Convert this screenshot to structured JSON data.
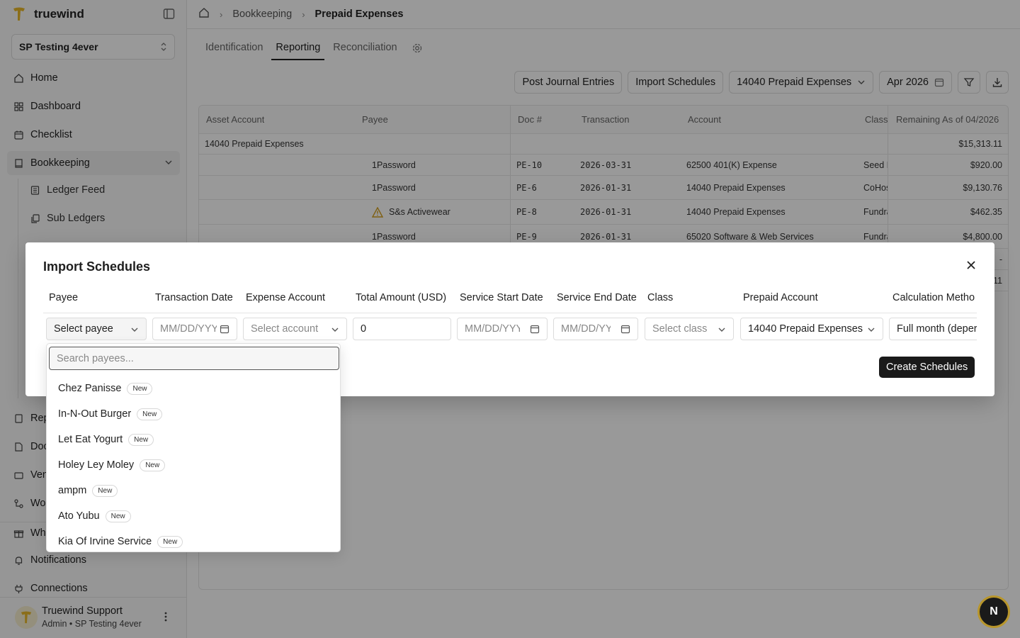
{
  "app": {
    "name": "truewind",
    "brand_color": "#e8b82a"
  },
  "sidebar": {
    "org": "SP Testing 4ever",
    "items": [
      {
        "label": "Home",
        "icon": "home-icon"
      },
      {
        "label": "Dashboard",
        "icon": "dashboard-icon"
      },
      {
        "label": "Checklist",
        "icon": "calendar-icon"
      },
      {
        "label": "Bookkeeping",
        "icon": "book-icon"
      }
    ],
    "sub_items": [
      {
        "label": "Ledger Feed",
        "icon": "ledger-icon"
      },
      {
        "label": "Sub Ledgers",
        "icon": "copy-icon"
      }
    ],
    "lower_items": [
      {
        "label": "Rep",
        "icon": "report-icon"
      },
      {
        "label": "Doc",
        "icon": "document-icon"
      },
      {
        "label": "Ven",
        "icon": "vendor-icon"
      },
      {
        "label": "Wor",
        "icon": "workflow-icon"
      },
      {
        "label": "Wha",
        "icon": "gift-icon"
      },
      {
        "label": "Notifications",
        "icon": "bell-icon"
      },
      {
        "label": "Connections",
        "icon": "plug-icon"
      }
    ],
    "user": {
      "initial": "T",
      "name": "Truewind Support",
      "role": "Admin • SP Testing 4ever"
    }
  },
  "breadcrumb": {
    "section": "Bookkeeping",
    "current": "Prepaid Expenses"
  },
  "tabs": [
    "Identification",
    "Reporting",
    "Reconciliation"
  ],
  "toolbar": {
    "post_label": "Post Journal Entries",
    "import_label": "Import Schedules",
    "account_filter": "14040 Prepaid Expenses",
    "period": "Apr 2026"
  },
  "table": {
    "headers": {
      "asset_account": "Asset Account",
      "payee": "Payee",
      "doc": "Doc #",
      "transaction": "Transaction",
      "account": "Account",
      "class": "Class",
      "remaining": "Remaining As of 04/2026"
    },
    "group": {
      "label": "14040 Prepaid Expenses",
      "remaining": "$15,313.11"
    },
    "rows": [
      {
        "payee": "1Password",
        "doc": "PE-10",
        "date": "2026-03-31",
        "account": "62500 401(K) Expense",
        "class": "Seed I",
        "remaining": "$920.00"
      },
      {
        "payee": "1Password",
        "doc": "PE-6",
        "date": "2026-01-31",
        "account": "14040 Prepaid Expenses",
        "class": "CoHos",
        "remaining": "$9,130.76"
      },
      {
        "payee": "S&s Activewear",
        "doc": "PE-8",
        "date": "2026-01-31",
        "account": "14040 Prepaid Expenses",
        "class": "Fundra",
        "remaining": "$462.35"
      },
      {
        "payee": "1Password",
        "doc": "PE-9",
        "date": "2026-01-31",
        "account": "65020 Software & Web Services",
        "class": "Fundra",
        "remaining": "$4,800.00"
      }
    ],
    "hidden_row_remaining_1": "-",
    "hidden_row_remaining_2": "11"
  },
  "modal": {
    "title": "Import Schedules",
    "columns": [
      "Payee",
      "Transaction Date",
      "Expense Account",
      "Total Amount (USD)",
      "Service Start Date",
      "Service End Date",
      "Class",
      "Prepaid Account",
      "Calculation Metho"
    ],
    "row": {
      "payee": "Select payee",
      "transaction_date_placeholder": "MM/DD/YYYY",
      "expense_account": "Select account",
      "total_amount": "0",
      "service_start_placeholder": "MM/DD/YYYY",
      "service_end_placeholder": "MM/DD/YYYY",
      "class": "Select class",
      "prepaid_account": "14040 Prepaid Expenses",
      "calculation_method": "Full month (deper"
    },
    "create_label": "Create Schedules"
  },
  "payee_dropdown": {
    "placeholder": "Search payees...",
    "badge": "New",
    "options": [
      "Chez Panisse",
      "In-N-Out Burger",
      "Let Eat Yogurt",
      "Holey Ley Moley",
      "ampm",
      "Ato Yubu",
      "Kia Of Irvine Service"
    ]
  },
  "floating_badge": "N"
}
